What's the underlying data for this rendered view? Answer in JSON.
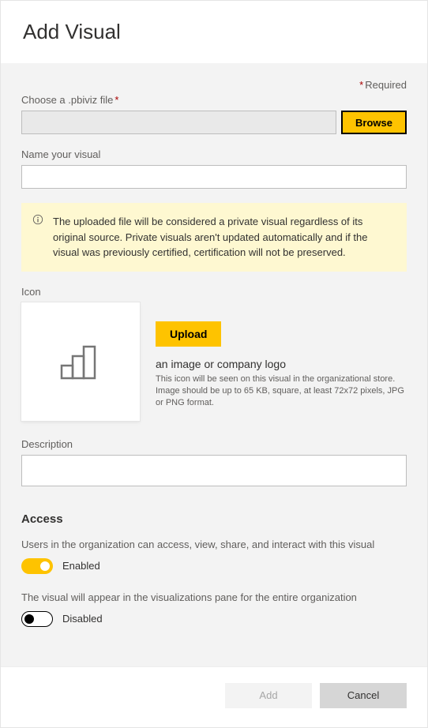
{
  "header": {
    "title": "Add Visual"
  },
  "required_label": "Required",
  "file": {
    "label": "Choose a .pbiviz file",
    "required": true,
    "browse_label": "Browse"
  },
  "name_field": {
    "label": "Name your visual"
  },
  "notice": "The uploaded file will be considered a private visual regardless of its original source. Private visuals aren't updated automatically and if the visual was previously certified, certification will not be preserved.",
  "icon_section": {
    "label": "Icon",
    "upload_label": "Upload",
    "heading": "an image or company logo",
    "description": "This icon will be seen on this visual in the organizational store. Image should be up to 65 KB, square, at least 72x72 pixels, JPG or PNG format."
  },
  "description_field": {
    "label": "Description"
  },
  "access": {
    "title": "Access",
    "items": [
      {
        "text": "Users in the organization can access, view, share, and interact with this visual",
        "enabled": true,
        "state_label": "Enabled"
      },
      {
        "text": "The visual will appear in the visualizations pane for the entire organization",
        "enabled": false,
        "state_label": "Disabled"
      }
    ]
  },
  "footer": {
    "add_label": "Add",
    "cancel_label": "Cancel"
  }
}
